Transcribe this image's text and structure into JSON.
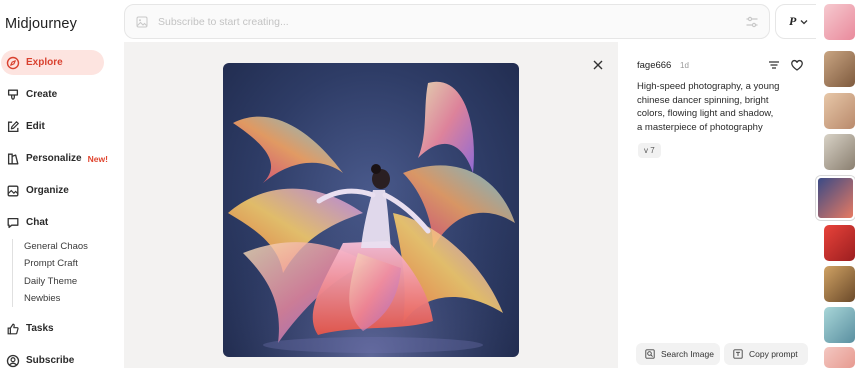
{
  "app": {
    "title": "Midjourney"
  },
  "sidebar": {
    "items": [
      {
        "label": "Explore",
        "icon": "compass-icon",
        "active": true
      },
      {
        "label": "Create",
        "icon": "brush-icon"
      },
      {
        "label": "Edit",
        "icon": "edit-icon"
      },
      {
        "label": "Personalize",
        "icon": "personalize-icon",
        "badge": "New!"
      },
      {
        "label": "Organize",
        "icon": "image-folder-icon"
      },
      {
        "label": "Chat",
        "icon": "chat-icon"
      }
    ],
    "chat_rooms": [
      "General Chaos",
      "Prompt Craft",
      "Daily Theme",
      "Newbies"
    ],
    "bottom_items": [
      {
        "label": "Tasks",
        "icon": "thumbs-up-icon"
      },
      {
        "label": "Subscribe",
        "icon": "user-circle-icon"
      }
    ]
  },
  "search": {
    "placeholder": "Subscribe to start creating..."
  },
  "mode": {
    "label": "P"
  },
  "details": {
    "author": "fage666",
    "age": "1d",
    "prompt": "High-speed photography, a young\nchinese dancer spinning, bright\ncolors, flowing light and shadow,\na masterpiece of photography",
    "version": "v 7",
    "search_image_label": "Search Image",
    "copy_prompt_label": "Copy prompt"
  },
  "colors": {
    "accent": "#d9412f",
    "active_bg": "#fde4e0",
    "badge": "#e0452f"
  }
}
